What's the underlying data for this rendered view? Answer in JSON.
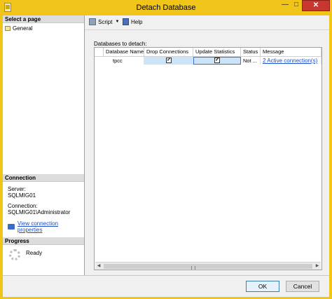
{
  "window": {
    "title": "Detach Database"
  },
  "left_pane": {
    "select_page_header": "Select a page",
    "pages": [
      "General"
    ],
    "connection_header": "Connection",
    "server_label": "Server:",
    "server_value": "SQLMIG01",
    "connection_label": "Connection:",
    "connection_value": "SQLMIG01\\Administrator",
    "view_connection_link": "View connection properties",
    "progress_header": "Progress",
    "progress_status": "Ready"
  },
  "toolbar": {
    "script_label": "Script",
    "help_label": "Help"
  },
  "grid_label": "Databases to detach:",
  "grid": {
    "columns": [
      "Database Name",
      "Drop Connections",
      "Update Statistics",
      "Status",
      "Message"
    ],
    "rows": [
      {
        "database_name": "tpcc",
        "drop_connections": true,
        "update_statistics": true,
        "status": "Not ...",
        "message": "2 Active connection(s)"
      }
    ]
  },
  "buttons": {
    "ok": "OK",
    "cancel": "Cancel"
  }
}
